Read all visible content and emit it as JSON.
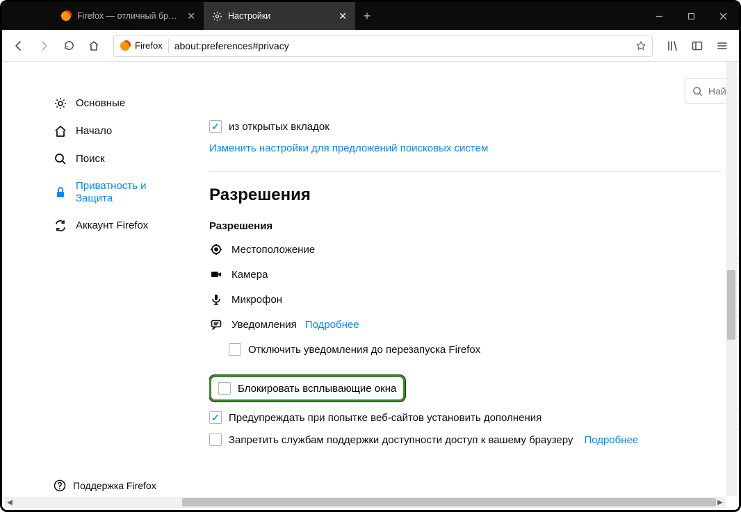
{
  "window": {
    "minimize": "—",
    "maximize": "□",
    "close": "✕"
  },
  "tabs": [
    {
      "title": "Firefox — отличный браузер",
      "active": false
    },
    {
      "title": "Настройки",
      "active": true
    }
  ],
  "toolbar": {
    "firefox_brand": "Firefox",
    "address": "about:preferences#privacy"
  },
  "sidebar": {
    "items": [
      {
        "label": "Основные"
      },
      {
        "label": "Начало"
      },
      {
        "label": "Поиск"
      },
      {
        "label": "Приватность и Защита"
      },
      {
        "label": "Аккаунт Firefox"
      }
    ],
    "support": "Поддержка Firefox"
  },
  "search": {
    "placeholder": "Найт"
  },
  "content": {
    "open_tabs_checkbox": "из открытых вкладок",
    "search_engines_link": "Изменить настройки для предложений поисковых систем",
    "section_title": "Разрешения",
    "sub_title": "Разрешения",
    "permissions": {
      "location": "Местоположение",
      "camera": "Камера",
      "microphone": "Микрофон",
      "notifications": "Уведомления",
      "notifications_more": "Подробнее",
      "notifications_disable": "Отключить уведомления до перезапуска Firefox"
    },
    "popup_block": "Блокировать всплывающие окна",
    "addons_warn": "Предупреждать при попытке веб-сайтов установить дополнения",
    "a11y_block": "Запретить службам поддержки доступности доступ к вашему браузеру",
    "a11y_more": "Подробнее"
  }
}
